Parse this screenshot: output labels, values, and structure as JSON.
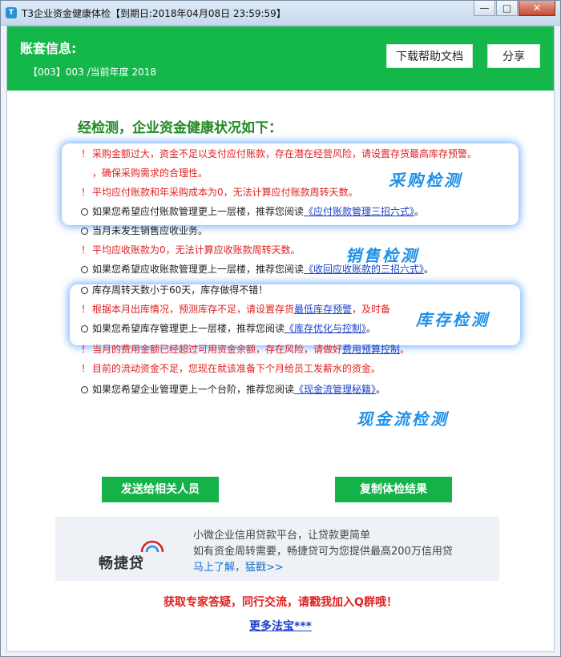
{
  "window": {
    "title": "T3企业资金健康体检【到期日:2018年04月08日 23:59:59】",
    "minimize_glyph": "—",
    "maximize_glyph": "□",
    "close_glyph": "✕"
  },
  "header": {
    "label": "账套信息:",
    "account": "【003】003 /当前年度 2018",
    "help_button": "下载帮助文档",
    "share_button": "分享"
  },
  "heading": "经检测，企业资金健康状况如下：",
  "results": [
    {
      "kind": "warn",
      "text": "采购金额过大，资金不足以支付应付账款，存在潜在经营风险，请设置存货最高库存预警。"
    },
    {
      "kind": "cont",
      "text": "，确保采购需求的合理性。"
    },
    {
      "kind": "warn",
      "text": "平均应付账款和年采购成本为0，无法计算应付账款周转天数。"
    },
    {
      "kind": "info",
      "text": "如果您希望应付账款管理更上一层楼，推荐您阅读",
      "link": "《应付账款管理三招六式》",
      "suffix": "。"
    },
    {
      "kind": "info",
      "text": "当月未发生销售应收业务。"
    },
    {
      "kind": "warn",
      "text": "平均应收账款为0，无法计算应收账款周转天数。"
    },
    {
      "kind": "info",
      "text": "如果您希望应收账款管理更上一层楼，推荐您阅读",
      "link": "《收回应收账款的三招六式》",
      "suffix": "。"
    },
    {
      "kind": "info",
      "text": "库存周转天数小于60天，库存做得不错！"
    },
    {
      "kind": "warn",
      "text": "根据本月出库情况，预测库存不足，请设置存货",
      "link": "最低库存预警",
      "suffix": "，及时备"
    },
    {
      "kind": "info",
      "text": "如果您希望库存管理更上一层楼，推荐您阅读",
      "link": "《库存优化与控制》",
      "suffix": "。"
    },
    {
      "kind": "warn",
      "text": "当月的费用金额已经超过可用资金余额，存在风险，请做好",
      "link": "费用预算控制",
      "suffix": "。"
    },
    {
      "kind": "warn",
      "text": "目前的流动资金不足，您现在就该准备下个月给员工发薪水的资金。"
    },
    {
      "kind": "info",
      "text": "如果您希望企业管理更上一个台阶，推荐您阅读",
      "link": "《现金流管理秘籍》",
      "suffix": "。"
    }
  ],
  "marks": {
    "warn": "！"
  },
  "tags": {
    "purchase": "采购检测",
    "sales": "销售检测",
    "inventory": "库存检测",
    "cashflow": "现金流检测"
  },
  "buttons": {
    "send": "发送给相关人员",
    "copy": "复制体检结果"
  },
  "ad": {
    "logo": "畅捷贷",
    "line1": "小微企业信用贷款平台，让贷款更简单",
    "line2": "如有资金周转需要，畅捷贷可为您提供最高200万信用贷",
    "line3": "马上了解，猛戳>>"
  },
  "footer": {
    "qq": "获取专家答疑，同行交流，请戳我加入Q群哦！",
    "more": "更多法宝***"
  },
  "colors": {
    "brand_green": "#14b84a",
    "warn_red": "#e0201f",
    "link_blue": "#1a3fc8",
    "tag_blue": "#1e90e8"
  }
}
